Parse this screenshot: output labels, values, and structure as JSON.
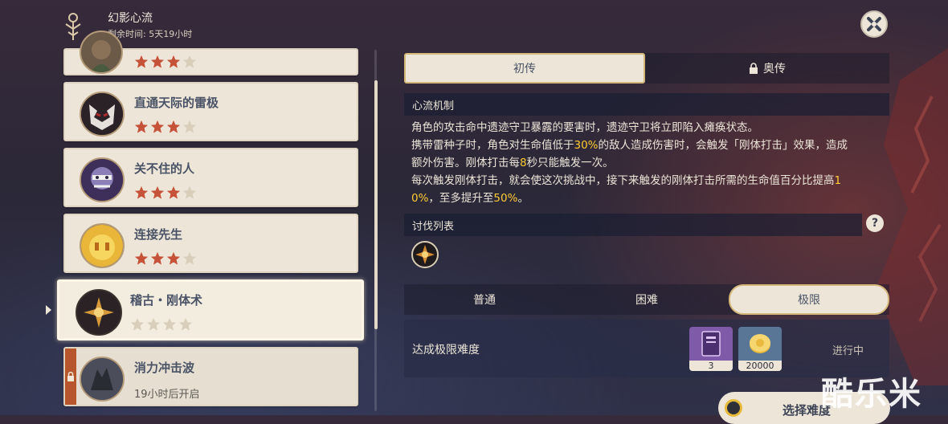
{
  "header": {
    "title": "幻影心流",
    "remaining": "剩余时间: 5天19小时"
  },
  "challenges": [
    {
      "name": "",
      "stars": 3,
      "max_stars": 4
    },
    {
      "name": "直通天际的雷极",
      "stars": 3,
      "max_stars": 4
    },
    {
      "name": "关不住的人",
      "stars": 3,
      "max_stars": 4
    },
    {
      "name": "连接先生",
      "stars": 3,
      "max_stars": 4
    },
    {
      "name": "稽古・刚体术",
      "stars": 0,
      "max_stars": 4,
      "selected": true
    },
    {
      "name": "消力冲击波",
      "locked": true,
      "status": "19小时后开启"
    }
  ],
  "tabs": [
    {
      "label": "初传",
      "active": true
    },
    {
      "label": "奥传",
      "active": false,
      "locked": true
    }
  ],
  "mechanics": {
    "heading": "心流机制",
    "line1": "角色的攻击命中遗迹守卫暴露的要害时，遗迹守卫将立即陷入瘫痪状态。",
    "line2_a": "携带雷种子时，角色对生命值低于",
    "line2_hl": "30%",
    "line2_b": "的敌人造成伤害时，会触发「刚体打击」效果，造成",
    "line3_a": "额外伤害。刚体打击每",
    "line3_hl": "8",
    "line3_b": "秒只能触发一次。",
    "line4_a": "每次触发刚体打击，就会使这次挑战中，接下来触发的刚体打击所需的生命值百分比提高",
    "line4_hl": "1",
    "line5_hl": "0%",
    "line5_a": "，至多提升至",
    "line5_hl2": "50%",
    "line5_b": "。"
  },
  "enemies": {
    "heading": "讨伐列表",
    "help": "?"
  },
  "difficulties": [
    {
      "label": "普通",
      "active": false
    },
    {
      "label": "困难",
      "active": false
    },
    {
      "label": "极限",
      "active": true
    }
  ],
  "reward": {
    "label": "达成极限难度",
    "items": [
      {
        "icon": "book-icon",
        "count": "3"
      },
      {
        "icon": "mora-coin-icon",
        "count": "20000"
      }
    ],
    "status": "进行中"
  },
  "select_button": "选择难度",
  "watermark": "酷乐米",
  "colors": {
    "card_bg": "#ece5d8",
    "name_text": "#4a5366",
    "star_filled": "#c6523a",
    "star_empty": "#d8ceba",
    "highlight": "#ffcc33",
    "lock_tab": "#b7552d"
  }
}
